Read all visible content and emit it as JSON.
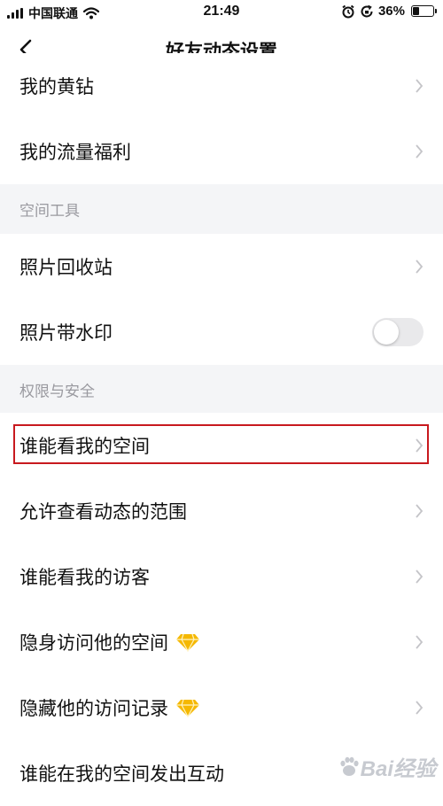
{
  "status_bar": {
    "carrier": "中国联通",
    "time": "21:49",
    "battery": "36%",
    "battery_level": 0.36
  },
  "nav": {
    "title": "好友动态设置",
    "back_icon": "chevron-left-icon"
  },
  "rows": {
    "yellow_diamond": "我的黄钻",
    "data_welfare": "我的流量福利",
    "photo_recycle_bin": "照片回收站",
    "photo_watermark": "照片带水印",
    "who_can_view_space": "谁能看我的空间",
    "allowed_feed_range": "允许查看动态的范围",
    "who_can_see_visitors": "谁能看我的访客",
    "stealth_visit": "隐身访问他的空间",
    "hide_visit_records": "隐藏他的访问记录",
    "who_can_interact": "谁能在我的空间发出互动"
  },
  "sections": {
    "space_tools": "空间工具",
    "privacy_security": "权限与安全"
  },
  "toggles": {
    "photo_watermark_on": false
  },
  "highlight": {
    "target": "who_can_view_space",
    "color": "#c8191e"
  },
  "watermark": {
    "text": "Bai经验",
    "icon": "baidu-paw-icon"
  },
  "colors": {
    "section_bg": "#f4f5f7",
    "section_text": "#9a9aa0",
    "chevron": "#c4c4c8",
    "diamond": "#f5b800"
  }
}
